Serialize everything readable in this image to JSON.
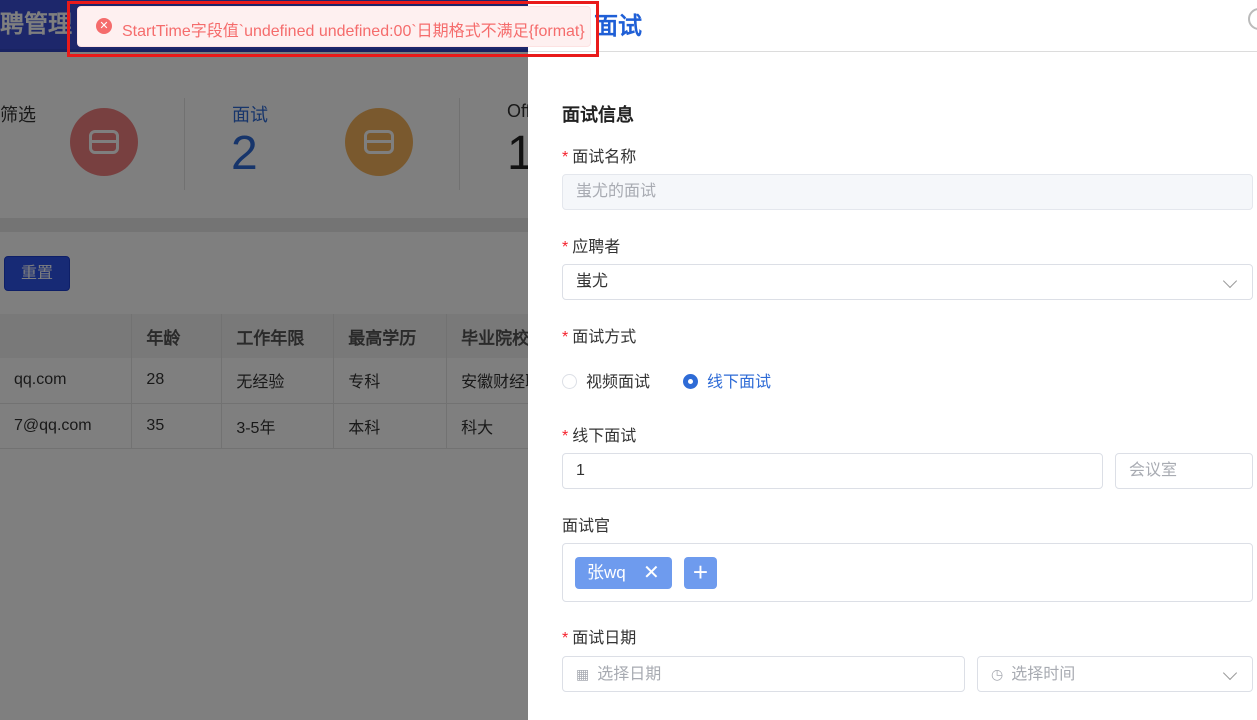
{
  "background_page": {
    "header_title": "聘管理",
    "stats": [
      {
        "label": "筛选"
      },
      {
        "label": "面试",
        "count": "2"
      },
      {
        "label": "Off",
        "count": "1"
      }
    ],
    "reset_label": "重置",
    "table": {
      "columns": [
        "",
        "年龄",
        "工作年限",
        "最高学历",
        "毕业院校"
      ],
      "rows": [
        [
          "qq.com",
          "28",
          "无经验",
          "专科",
          "安徽财经职"
        ],
        [
          "7@qq.com",
          "35",
          "3-5年",
          "本科",
          "科大"
        ]
      ]
    }
  },
  "drawer": {
    "title": "面试",
    "section_title": "面试信息",
    "fields": {
      "interview_name": {
        "label": "面试名称",
        "value": "蚩尤的面试"
      },
      "applicant": {
        "label": "应聘者",
        "value": "蚩尤"
      },
      "method": {
        "label": "面试方式",
        "options": [
          "视频面试",
          "线下面试"
        ],
        "selected": "线下面试"
      },
      "offline": {
        "label": "线下面试",
        "value": "1",
        "room_placeholder": "会议室"
      },
      "interviewers": {
        "label": "面试官",
        "tags": [
          "张wq"
        ]
      },
      "date": {
        "label": "面试日期",
        "date_placeholder": "选择日期",
        "time_placeholder": "选择时间"
      }
    }
  },
  "toast": {
    "type": "error",
    "message": "StartTime字段值`undefined undefined:00`日期格式不满足{format}"
  },
  "colors": {
    "primary": "#2e6bd6",
    "error": "#f56c6c",
    "highlight_frame": "#e91a1a",
    "tag": "#6e9bee"
  }
}
